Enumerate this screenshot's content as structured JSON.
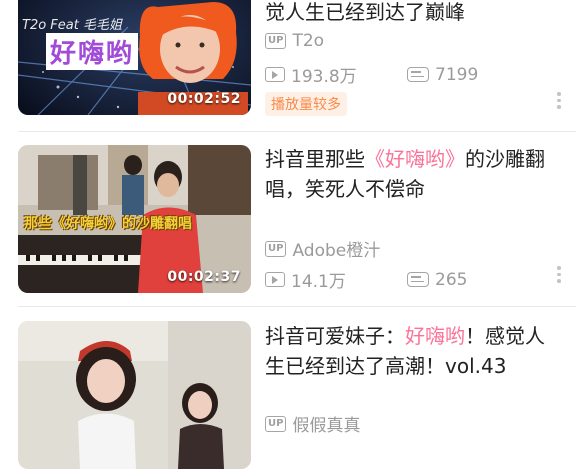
{
  "videos": [
    {
      "title": "觉人生已经到达了巅峰",
      "title_parts": [
        "觉人生已经到达了巅峰"
      ],
      "uploader": "T2o",
      "views": "193.8万",
      "danmaku": "7199",
      "tag": "播放量较多",
      "duration": "00:02:52",
      "thumb_caption": "好嗨哟",
      "thumb_top_text": "T2o Feat 毛毛姐"
    },
    {
      "title_parts": [
        "抖音里那些",
        "《好嗨哟》",
        "的沙雕翻唱，笑死人不偿命"
      ],
      "uploader": "Adobe橙汁",
      "views": "14.1万",
      "danmaku": "265",
      "duration": "00:02:37",
      "thumb_caption": "那些《好嗨哟》的沙雕翻唱"
    },
    {
      "title_parts": [
        "抖音可爱妹子：",
        "好嗨哟",
        "！感觉人生已经到达了高潮！vol.43"
      ],
      "uploader": "假假真真"
    }
  ],
  "labels": {
    "up_badge": "UP"
  },
  "colors": {
    "highlight": "#fb7299",
    "tag_text": "#fa8a4a",
    "tag_bg": "#fff0e6",
    "meta": "#9a9a9a"
  }
}
